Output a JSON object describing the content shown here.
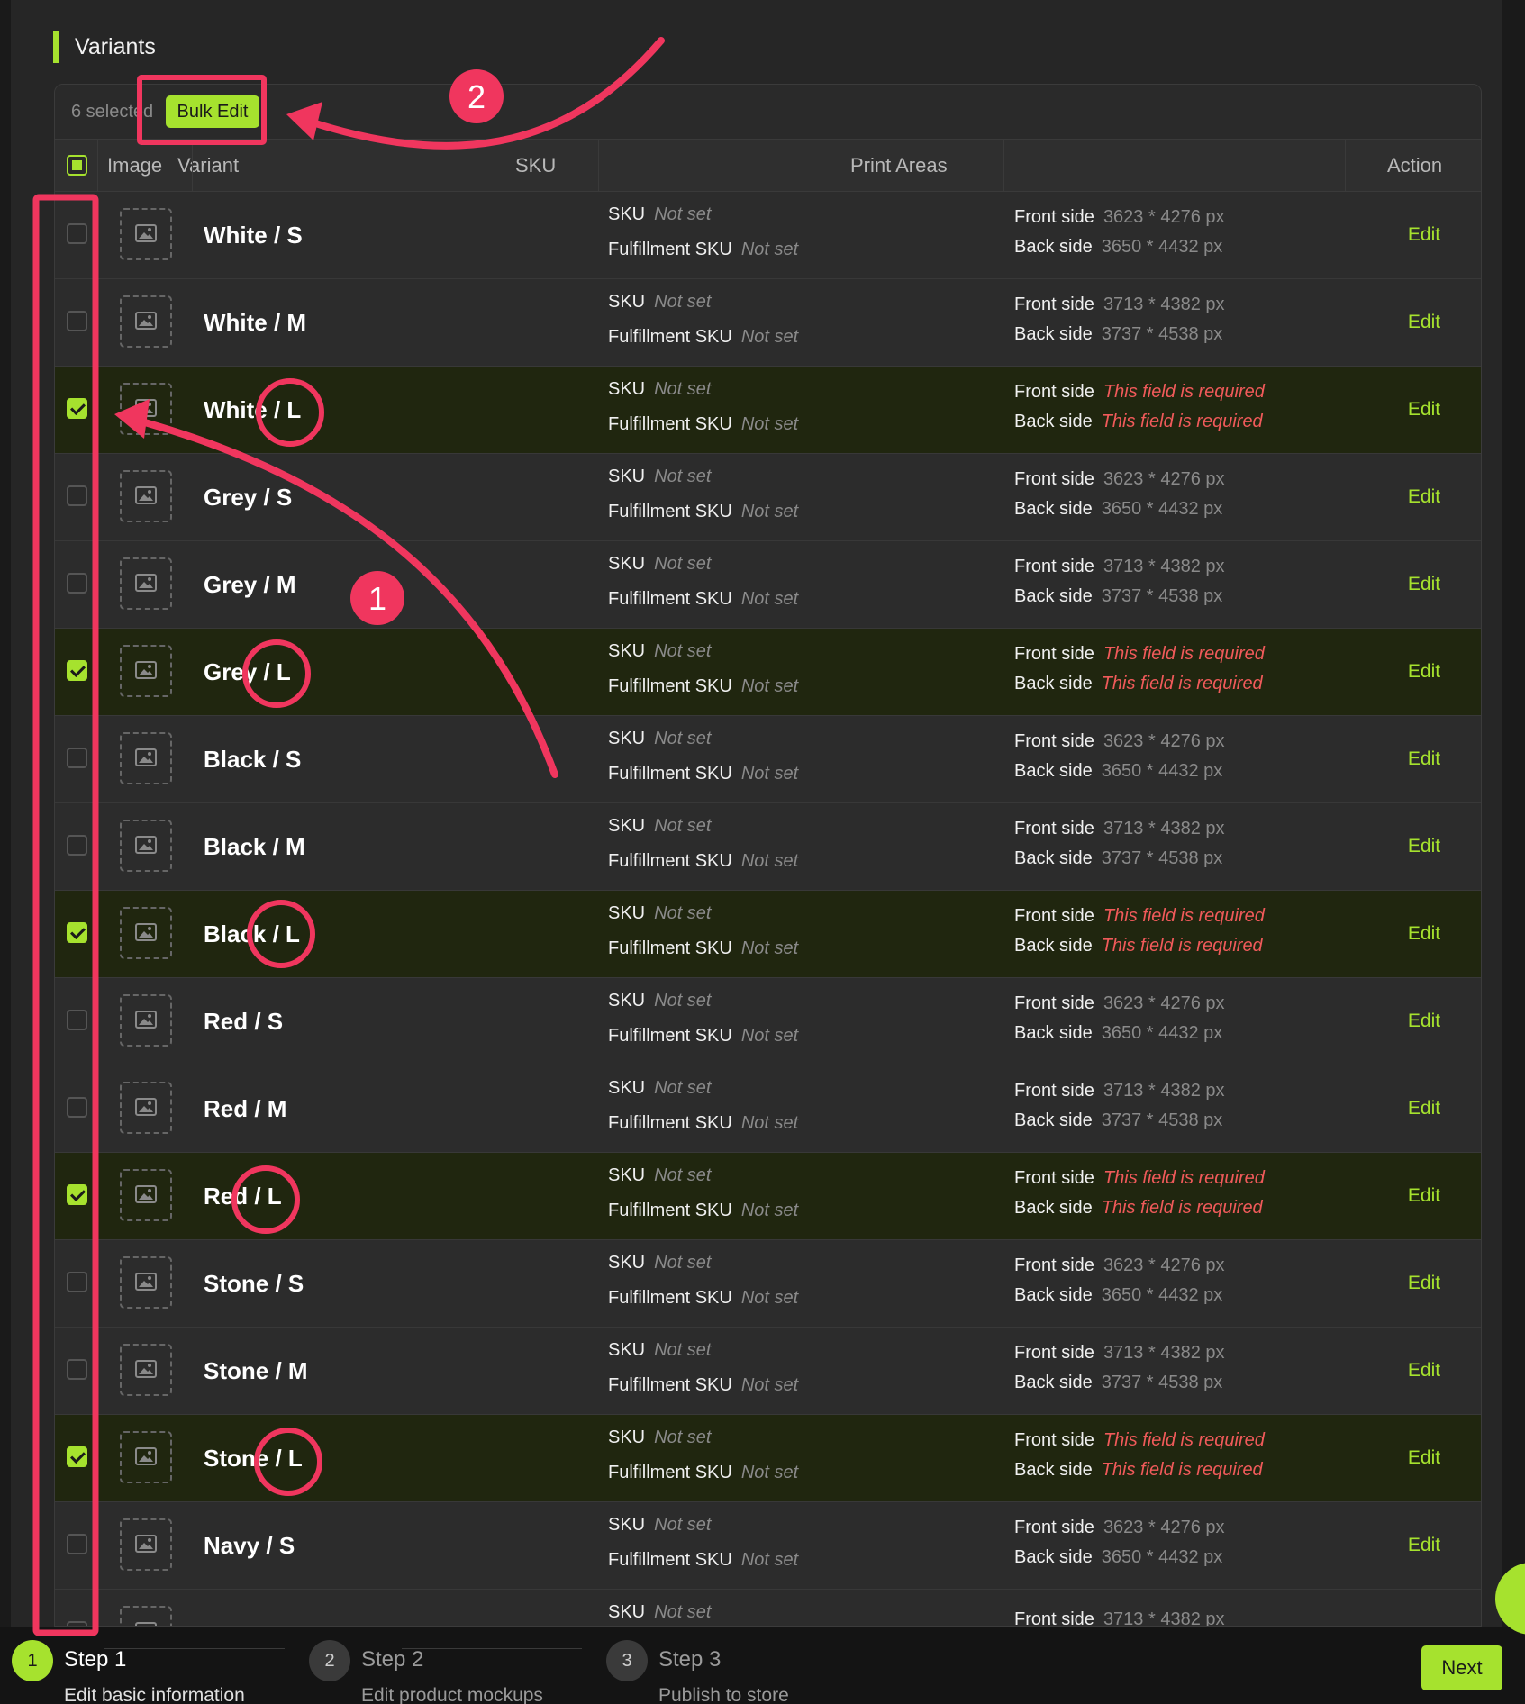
{
  "section": {
    "title": "Variants"
  },
  "bulk": {
    "selected_text": "6 selected",
    "bulk_edit_label": "Bulk Edit"
  },
  "headers": {
    "image": "Image",
    "variant": "Variant",
    "sku": "SKU",
    "print_areas": "Print Areas",
    "action": "Action"
  },
  "labels": {
    "sku": "SKU",
    "fulfillment_sku": "Fulfillment SKU",
    "not_set": "Not set",
    "front_side": "Front side",
    "back_side": "Back side",
    "edit": "Edit"
  },
  "variants": [
    {
      "name": "White / S",
      "selected": false,
      "front": "3623 * 4276 px",
      "back": "3650 * 4432 px",
      "error": false
    },
    {
      "name": "White / M",
      "selected": false,
      "front": "3713 * 4382 px",
      "back": "3737 * 4538 px",
      "error": false
    },
    {
      "name": "White / L",
      "selected": true,
      "front": "This field is required",
      "back": "This field is required",
      "error": true
    },
    {
      "name": "Grey / S",
      "selected": false,
      "front": "3623 * 4276 px",
      "back": "3650 * 4432 px",
      "error": false
    },
    {
      "name": "Grey / M",
      "selected": false,
      "front": "3713 * 4382 px",
      "back": "3737 * 4538 px",
      "error": false
    },
    {
      "name": "Grey / L",
      "selected": true,
      "front": "This field is required",
      "back": "This field is required",
      "error": true
    },
    {
      "name": "Black / S",
      "selected": false,
      "front": "3623 * 4276 px",
      "back": "3650 * 4432 px",
      "error": false
    },
    {
      "name": "Black / M",
      "selected": false,
      "front": "3713 * 4382 px",
      "back": "3737 * 4538 px",
      "error": false
    },
    {
      "name": "Black / L",
      "selected": true,
      "front": "This field is required",
      "back": "This field is required",
      "error": true
    },
    {
      "name": "Red / S",
      "selected": false,
      "front": "3623 * 4276 px",
      "back": "3650 * 4432 px",
      "error": false
    },
    {
      "name": "Red / M",
      "selected": false,
      "front": "3713 * 4382 px",
      "back": "3737 * 4538 px",
      "error": false
    },
    {
      "name": "Red / L",
      "selected": true,
      "front": "This field is required",
      "back": "This field is required",
      "error": true
    },
    {
      "name": "Stone / S",
      "selected": false,
      "front": "3623 * 4276 px",
      "back": "3650 * 4432 px",
      "error": false
    },
    {
      "name": "Stone / M",
      "selected": false,
      "front": "3713 * 4382 px",
      "back": "3737 * 4538 px",
      "error": false
    },
    {
      "name": "Stone / L",
      "selected": true,
      "front": "This field is required",
      "back": "This field is required",
      "error": true
    },
    {
      "name": "Navy / S",
      "selected": false,
      "front": "3623 * 4276 px",
      "back": "3650 * 4432 px",
      "error": false
    },
    {
      "name": "",
      "selected": false,
      "front": "3713 * 4382 px",
      "back": "",
      "error": false
    }
  ],
  "steps": [
    {
      "num": "1",
      "title": "Step 1",
      "subtitle": "Edit basic information",
      "active": true
    },
    {
      "num": "2",
      "title": "Step 2",
      "subtitle": "Edit product mockups",
      "active": false
    },
    {
      "num": "3",
      "title": "Step 3",
      "subtitle": "Publish to store",
      "active": false
    }
  ],
  "next_label": "Next",
  "annotations": {
    "badge_1": "1",
    "badge_2": "2"
  },
  "colors": {
    "accent": "#a6e22e",
    "annotation": "#f0365e",
    "error": "#f05a5a",
    "selected_row": "#20260f"
  },
  "icons": {
    "image_placeholder": "image-icon",
    "checkbox": "checkbox"
  }
}
